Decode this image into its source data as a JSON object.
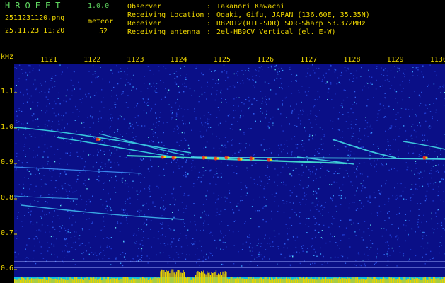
{
  "header": {
    "app_title": "HROFFT",
    "app_version": "1.0.0",
    "file_name": "2511231120.png",
    "timestamp": "25.11.23 11:20",
    "meteor_label": "meteor",
    "meteor_count": "52"
  },
  "info": [
    {
      "key": "Observer",
      "value": "Takanori Kawachi"
    },
    {
      "key": "Receiving Location",
      "value": "Ogaki, Gifu, JAPAN (136.60E, 35.35N)"
    },
    {
      "key": "Receiver",
      "value": "R820T2(RTL-SDR) SDR-Sharp 53.372MHz"
    },
    {
      "key": "Receiving antenna",
      "value": "2el-HB9CV Vertical (el. E-W)"
    }
  ],
  "separator": ":",
  "spectrogram": {
    "unit_label": "kHz",
    "x_ticks": [
      "1121",
      "1122",
      "1123",
      "1124",
      "1125",
      "1126",
      "1127",
      "1128",
      "1129",
      "1130"
    ],
    "y_ticks": [
      "1.1",
      "1.0",
      "0.9",
      "0.8",
      "0.7",
      "0.6"
    ],
    "colors": {
      "background": "#0a0f87",
      "text": "#f0d800",
      "header_green": "#5fd65f",
      "signal": "#00d8d8"
    }
  }
}
